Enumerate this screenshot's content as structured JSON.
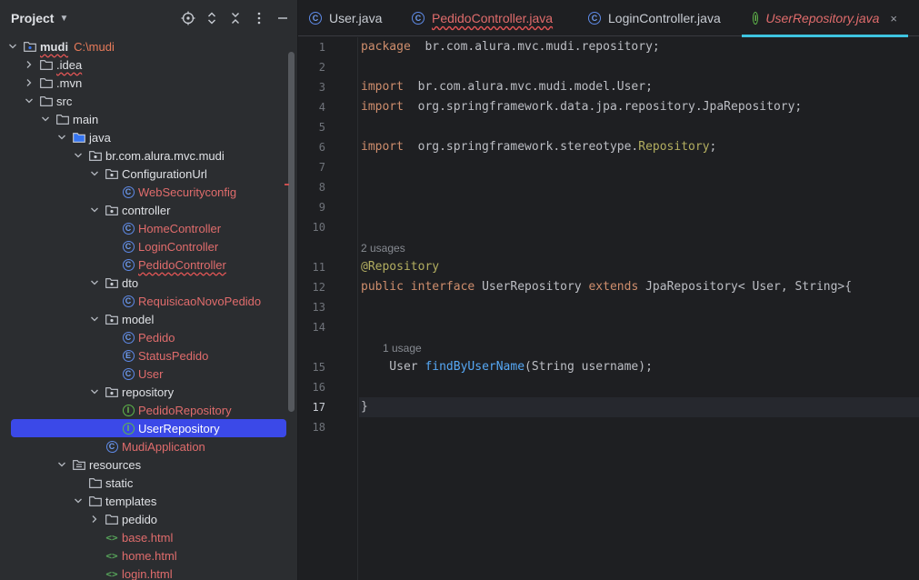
{
  "project_panel": {
    "title": "Project",
    "header_icons": [
      "locate-icon",
      "expand-collapse-icon",
      "collapse-all-icon",
      "more-options-icon",
      "minimize-icon"
    ],
    "tree": [
      {
        "label": "mudi",
        "hint": "C:\\mudi",
        "kind": "module",
        "expanded": true,
        "bold": true
      },
      {
        "label": ".idea",
        "kind": "folder",
        "expanded": false
      },
      {
        "label": ".mvn",
        "kind": "folder",
        "expanded": false
      },
      {
        "label": "src",
        "kind": "folder",
        "expanded": true
      },
      {
        "label": "main",
        "kind": "folder",
        "expanded": true
      },
      {
        "label": "java",
        "kind": "source-folder",
        "expanded": true
      },
      {
        "label": "br.com.alura.mvc.mudi",
        "kind": "package",
        "expanded": true
      },
      {
        "label": "ConfigurationUrl",
        "kind": "package",
        "expanded": true
      },
      {
        "label": "WebSecurityconfig",
        "kind": "class"
      },
      {
        "label": "controller",
        "kind": "package",
        "expanded": true
      },
      {
        "label": "HomeController",
        "kind": "class"
      },
      {
        "label": "LoginController",
        "kind": "class"
      },
      {
        "label": "PedidoController",
        "kind": "class"
      },
      {
        "label": "dto",
        "kind": "package",
        "expanded": true
      },
      {
        "label": "RequisicaoNovoPedido",
        "kind": "class"
      },
      {
        "label": "model",
        "kind": "package",
        "expanded": true
      },
      {
        "label": "Pedido",
        "kind": "class"
      },
      {
        "label": "StatusPedido",
        "kind": "enum"
      },
      {
        "label": "User",
        "kind": "class"
      },
      {
        "label": "repository",
        "kind": "package",
        "expanded": true
      },
      {
        "label": "PedidoRepository",
        "kind": "interface"
      },
      {
        "label": "UserRepository",
        "kind": "interface",
        "selected": true
      },
      {
        "label": "MudiApplication",
        "kind": "class"
      },
      {
        "label": "resources",
        "kind": "resources-folder",
        "expanded": true
      },
      {
        "label": "static",
        "kind": "folder"
      },
      {
        "label": "templates",
        "kind": "folder",
        "expanded": true
      },
      {
        "label": "pedido",
        "kind": "folder",
        "expanded": false
      },
      {
        "label": "base.html",
        "kind": "html"
      },
      {
        "label": "home.html",
        "kind": "html"
      },
      {
        "label": "login.html",
        "kind": "html"
      }
    ]
  },
  "tabs": [
    {
      "label": "User.java",
      "state": "normal"
    },
    {
      "label": "PedidoController.java",
      "state": "error"
    },
    {
      "label": "LoginController.java",
      "state": "normal"
    },
    {
      "label": "UserRepository.java",
      "state": "active",
      "close": "×"
    }
  ],
  "editor": {
    "current_line": "17",
    "lines": [
      {
        "n": "1",
        "code": [
          [
            "kw",
            "package"
          ],
          [
            "",
            "  br.com.alura.mvc.mudi.repository;"
          ]
        ]
      },
      {
        "n": "2",
        "code": []
      },
      {
        "n": "3",
        "code": [
          [
            "kw",
            "import"
          ],
          [
            "",
            "  br.com.alura.mvc.mudi.model.User;"
          ]
        ]
      },
      {
        "n": "4",
        "code": [
          [
            "kw",
            "import"
          ],
          [
            "",
            "  org.springframework.data.jpa.repository.JpaRepository;"
          ]
        ]
      },
      {
        "n": "5",
        "code": []
      },
      {
        "n": "6",
        "code": [
          [
            "kw",
            "import"
          ],
          [
            "",
            "  org.springframework.stereotype."
          ],
          [
            "ann",
            "Repository"
          ],
          [
            "",
            ";"
          ]
        ]
      },
      {
        "n": "7",
        "code": []
      },
      {
        "n": "8",
        "code": []
      },
      {
        "n": "9",
        "code": []
      },
      {
        "n": "10",
        "code": []
      },
      {
        "n": "11",
        "code": [
          [
            "ann",
            "@Repository"
          ]
        ],
        "usage_before": "2 usages"
      },
      {
        "n": "12",
        "code": [
          [
            "kw",
            "public"
          ],
          [
            "",
            ""
          ],
          [
            "kw",
            " interface"
          ],
          [
            "",
            " UserRepository "
          ],
          [
            "kw",
            "extends"
          ],
          [
            "",
            " JpaRepository< User, String>{"
          ]
        ]
      },
      {
        "n": "13",
        "code": []
      },
      {
        "n": "14",
        "code": []
      },
      {
        "n": "15",
        "code": [
          [
            "",
            "    User "
          ],
          [
            "fn",
            "findByUserName"
          ],
          [
            "",
            "(String username);"
          ]
        ],
        "usage_before": "1 usage"
      },
      {
        "n": "16",
        "code": []
      },
      {
        "n": "17",
        "code": [
          [
            "",
            "}"
          ]
        ]
      },
      {
        "n": "18",
        "code": []
      }
    ]
  }
}
